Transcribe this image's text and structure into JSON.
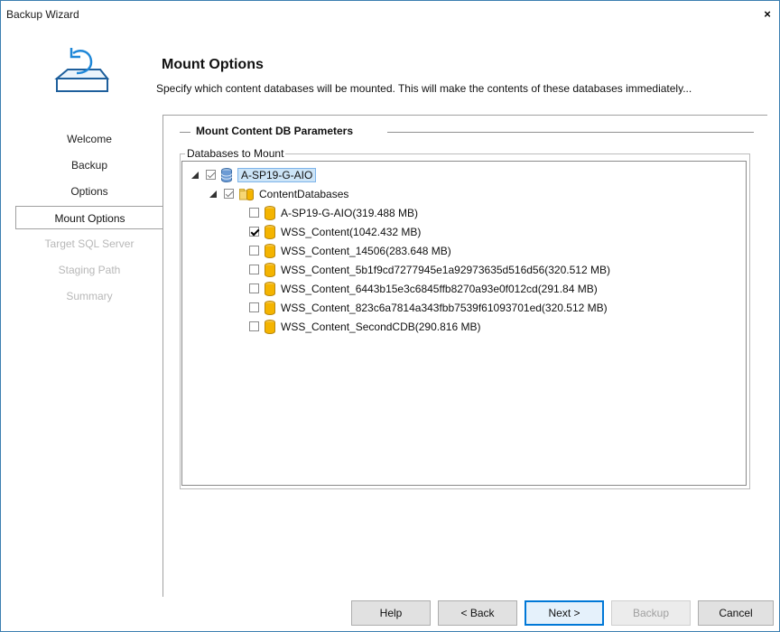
{
  "window": {
    "title": "Backup Wizard",
    "close_glyph": "×"
  },
  "header": {
    "title": "Mount Options",
    "description": "Specify which content databases will be mounted. This will make the contents of these databases immediately..."
  },
  "steps": [
    {
      "label": "Welcome",
      "state": "done"
    },
    {
      "label": "Backup",
      "state": "done"
    },
    {
      "label": "Options",
      "state": "done"
    },
    {
      "label": "Mount Options",
      "state": "active"
    },
    {
      "label": "Target SQL Server",
      "state": "disabled"
    },
    {
      "label": "Staging Path",
      "state": "disabled"
    },
    {
      "label": "Summary",
      "state": "disabled"
    }
  ],
  "section": {
    "heading": "Mount Content DB Parameters"
  },
  "group": {
    "label": "Databases to Mount"
  },
  "tree": {
    "root": {
      "label": "A-SP19-G-AIO",
      "checked": "partial",
      "icon": "server-database-icon"
    },
    "folder": {
      "label": "ContentDatabases",
      "checked": "partial",
      "icon": "folder-database-icon"
    },
    "databases": [
      {
        "label": "A-SP19-G-AIO(319.488 MB)",
        "checked": false
      },
      {
        "label": "WSS_Content(1042.432 MB)",
        "checked": true
      },
      {
        "label": "WSS_Content_14506(283.648 MB)",
        "checked": false
      },
      {
        "label": "WSS_Content_5b1f9cd7277945e1a92973635d516d56(320.512 MB)",
        "checked": false
      },
      {
        "label": "WSS_Content_6443b15e3c6845ffb8270a93e0f012cd(291.84 MB)",
        "checked": false
      },
      {
        "label": "WSS_Content_823c6a7814a343fbb7539f61093701ed(320.512 MB)",
        "checked": false
      },
      {
        "label": "WSS_Content_SecondCDB(290.816 MB)",
        "checked": false
      }
    ]
  },
  "buttons": {
    "help": "Help",
    "back": "< Back",
    "next": "Next >",
    "backup": "Backup",
    "cancel": "Cancel"
  },
  "colors": {
    "accent": "#0078d7",
    "selection": "#cce4f7",
    "db_yellow": "#f4b400"
  }
}
